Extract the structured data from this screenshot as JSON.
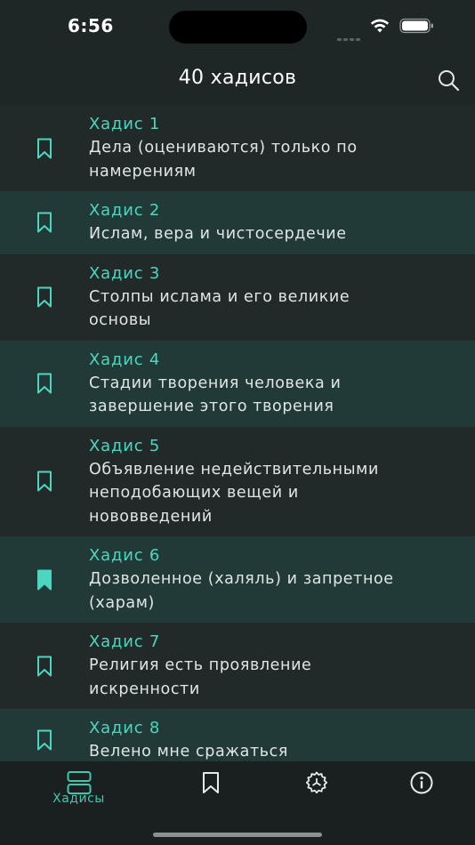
{
  "status_bar": {
    "time": "6:56"
  },
  "header": {
    "title": "40 хадисов",
    "search_icon": "search-icon"
  },
  "colors": {
    "accent": "#4dd6bf",
    "background": "#1f2626",
    "row_odd": "#212a29",
    "row_even": "#223a37",
    "text": "#dfe6e5"
  },
  "hadiths": [
    {
      "number": "Хадис 1",
      "title_lines": [
        "Дела (оцениваются) только по",
        "намерениям"
      ],
      "bookmarked": false
    },
    {
      "number": "Хадис 2",
      "title_lines": [
        "Ислам, вера и чистосердечие"
      ],
      "bookmarked": false
    },
    {
      "number": "Хадис 3",
      "title_lines": [
        "Столпы ислама и его великие",
        "основы"
      ],
      "bookmarked": false
    },
    {
      "number": "Хадис 4",
      "title_lines": [
        "Стадии творения человека и",
        "завершение этого творения"
      ],
      "bookmarked": false
    },
    {
      "number": "Хадис 5",
      "title_lines": [
        "Объявление недействительными",
        "неподобающих вещей и",
        "нововведений"
      ],
      "bookmarked": false
    },
    {
      "number": "Хадис 6",
      "title_lines": [
        "Дозволенное (халяль) и запретное",
        "(харам)"
      ],
      "bookmarked": true
    },
    {
      "number": "Хадис 7",
      "title_lines": [
        "Религия есть проявление",
        "искренности"
      ],
      "bookmarked": false
    },
    {
      "number": "Хадис 8",
      "title_lines": [
        "Велено мне сражаться"
      ],
      "bookmarked": false
    }
  ],
  "tab_bar": {
    "tabs": [
      {
        "id": "hadiths",
        "label": "Хадисы",
        "icon": "list-icon",
        "active": true
      },
      {
        "id": "bookmarks",
        "label": "",
        "icon": "bookmark-icon",
        "active": false
      },
      {
        "id": "settings",
        "label": "",
        "icon": "settings-icon",
        "active": false
      },
      {
        "id": "info",
        "label": "",
        "icon": "info-icon",
        "active": false
      }
    ]
  }
}
